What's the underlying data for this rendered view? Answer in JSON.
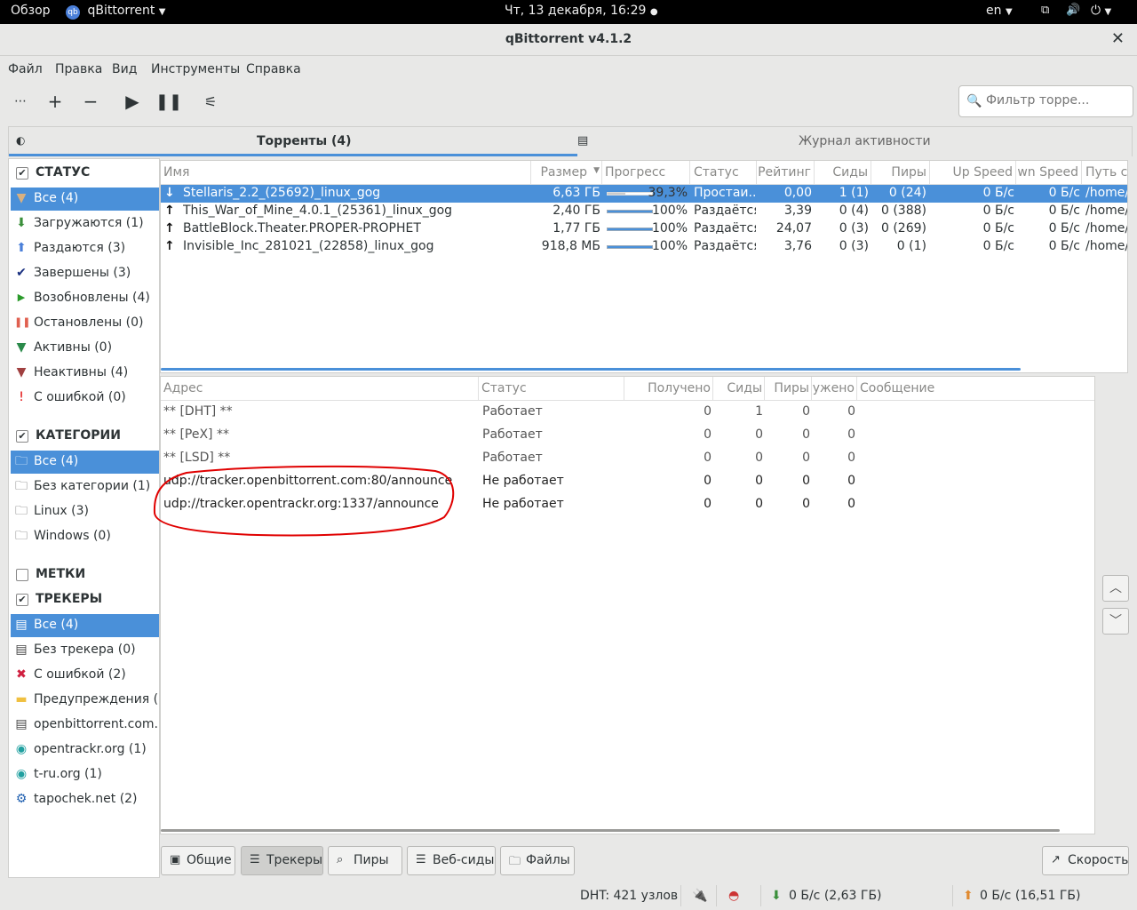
{
  "topbar": {
    "overview": "Обзор",
    "app": "qBittorrent",
    "datetime": "Чт, 13 декабря, 16:29",
    "lang": "en"
  },
  "window": {
    "title": "qBittorrent v4.1.2"
  },
  "menu": [
    "Файл",
    "Правка",
    "Вид",
    "Инструменты",
    "Справка"
  ],
  "filter": {
    "placeholder": "Фильтр торре..."
  },
  "tabs": {
    "torrents": "Торренты (4)",
    "log": "Журнал активности"
  },
  "sidebar": {
    "status_header": "СТАТУС",
    "status": [
      {
        "label": "Все (4)",
        "icon": "filter-icon",
        "color": "#c8a06a"
      },
      {
        "label": "Загружаются (1)",
        "icon": "arrow-down-icon",
        "color": "#3a8f3a"
      },
      {
        "label": "Раздаются (3)",
        "icon": "arrow-up-icon",
        "color": "#4a7fd9"
      },
      {
        "label": "Завершены (3)",
        "icon": "check-icon",
        "color": "#1a3080"
      },
      {
        "label": "Возобновлены (4)",
        "icon": "play-icon",
        "color": "#2a9a2a"
      },
      {
        "label": "Остановлены (0)",
        "icon": "pause-icon",
        "color": "#e06050"
      },
      {
        "label": "Активны (0)",
        "icon": "filter-green-icon",
        "color": "#2a8a4a"
      },
      {
        "label": "Неактивны (4)",
        "icon": "filter-red-icon",
        "color": "#a04040"
      },
      {
        "label": "С ошибкой (0)",
        "icon": "error-icon",
        "color": "#e00000"
      }
    ],
    "categories_header": "КАТЕГОРИИ",
    "categories": [
      "Все (4)",
      "Без категории (1)",
      "Linux (3)",
      "Windows (0)"
    ],
    "tags_header": "МЕТКИ",
    "trackers_header": "ТРЕКЕРЫ",
    "trackers": [
      {
        "label": "Все (4)",
        "icon": "server-icon"
      },
      {
        "label": "Без трекера (0)",
        "icon": "server-icon"
      },
      {
        "label": "С ошибкой (2)",
        "icon": "error-x-icon"
      },
      {
        "label": "Предупреждения (...",
        "icon": "warning-icon"
      },
      {
        "label": "openbittorrent.com...",
        "icon": "server-icon"
      },
      {
        "label": "opentrackr.org (1)",
        "icon": "globe-icon"
      },
      {
        "label": "t-ru.org (1)",
        "icon": "globe-icon"
      },
      {
        "label": "tapochek.net (2)",
        "icon": "site-icon"
      }
    ]
  },
  "torrents": {
    "columns": [
      "Имя",
      "Размер",
      "Прогресс",
      "Статус",
      "Рейтинг",
      "Сиды",
      "Пиры",
      "Up Speed",
      "wn Speed",
      "Путь со"
    ],
    "rows": [
      {
        "dir": "down",
        "name": "Stellaris_2.2_(25692)_linux_gog",
        "size": "6,63 ГБ",
        "progress": 0.393,
        "progress_label": "39,3%",
        "status": "Простаи...",
        "ratio": "0,00",
        "seeds": "1 (1)",
        "peers": "0 (24)",
        "up": "0 Б/с",
        "down": "0 Б/с",
        "path": "/home/"
      },
      {
        "dir": "up",
        "name": "This_War_of_Mine_4.0.1_(25361)_linux_gog",
        "size": "2,40 ГБ",
        "progress": 1.0,
        "progress_label": "100%",
        "status": "Раздаётся",
        "ratio": "3,39",
        "seeds": "0 (4)",
        "peers": "0 (388)",
        "up": "0 Б/с",
        "down": "0 Б/с",
        "path": "/home/"
      },
      {
        "dir": "up",
        "name": "BattleBlock.Theater.PROPER-PROPHET",
        "size": "1,77 ГБ",
        "progress": 1.0,
        "progress_label": "100%",
        "status": "Раздаётся",
        "ratio": "24,07",
        "seeds": "0 (3)",
        "peers": "0 (269)",
        "up": "0 Б/с",
        "down": "0 Б/с",
        "path": "/home/"
      },
      {
        "dir": "up",
        "name": "Invisible_Inc_281021_(22858)_linux_gog",
        "size": "918,8 МБ",
        "progress": 1.0,
        "progress_label": "100%",
        "status": "Раздаётся",
        "ratio": "3,76",
        "seeds": "0 (3)",
        "peers": "0 (1)",
        "up": "0 Б/с",
        "down": "0 Б/с",
        "path": "/home/"
      }
    ]
  },
  "trackers_table": {
    "columns": [
      "Адрес",
      "Статус",
      "Получено",
      "Сиды",
      "Пиры",
      "ужено",
      "Сообщение"
    ],
    "rows": [
      {
        "url": "** [DHT] **",
        "status": "Работает",
        "received": "0",
        "seeds": "1",
        "peers": "0",
        "dl": "0"
      },
      {
        "url": "** [PeX] **",
        "status": "Работает",
        "received": "0",
        "seeds": "0",
        "peers": "0",
        "dl": "0"
      },
      {
        "url": "** [LSD] **",
        "status": "Работает",
        "received": "0",
        "seeds": "0",
        "peers": "0",
        "dl": "0"
      },
      {
        "url": "udp://tracker.openbittorrent.com:80/announce",
        "status": "Не работает",
        "received": "0",
        "seeds": "0",
        "peers": "0",
        "dl": "0"
      },
      {
        "url": "udp://tracker.opentrackr.org:1337/announce",
        "status": "Не работает",
        "received": "0",
        "seeds": "0",
        "peers": "0",
        "dl": "0"
      }
    ]
  },
  "bottom_tabs": [
    "Общие",
    "Трекеры",
    "Пиры",
    "Веб-сиды",
    "Файлы"
  ],
  "speed_button": "Скорость",
  "status": {
    "dht": "DHT: 421 узлов",
    "down": "0 Б/с (2,63 ГБ)",
    "up": "0 Б/с (16,51 ГБ)"
  }
}
